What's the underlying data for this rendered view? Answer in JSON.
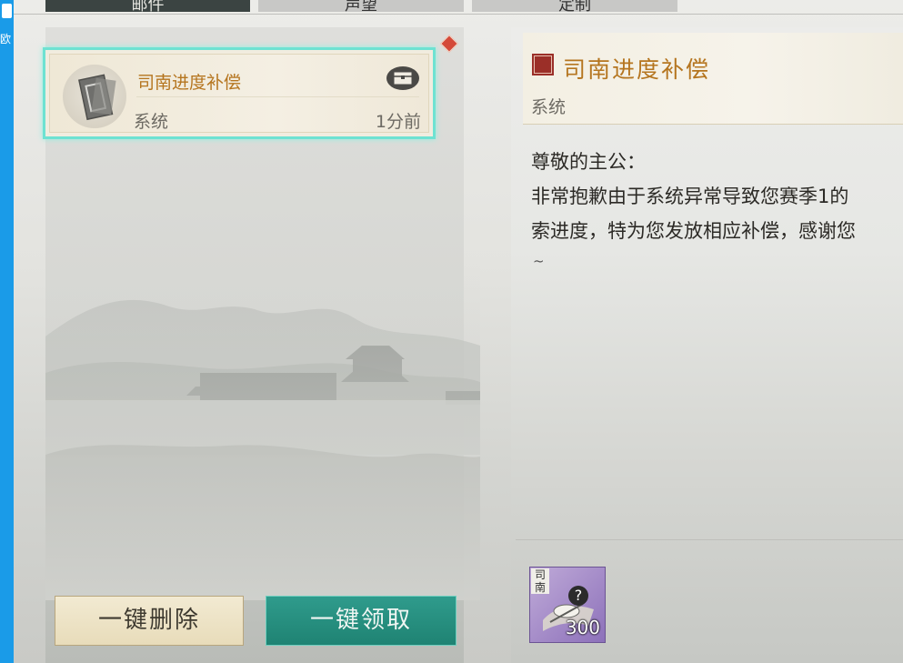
{
  "desktop": {
    "side_text": "欧"
  },
  "tabs": [
    {
      "label": "邮件"
    },
    {
      "label": "声望"
    },
    {
      "label": "定制"
    }
  ],
  "mail_list": {
    "items": [
      {
        "title": "司南进度补偿",
        "sender": "系统",
        "time": "1分前",
        "unread": true,
        "has_attachment": true
      }
    ]
  },
  "buttons": {
    "delete_all": "一键删除",
    "claim_all": "一键领取"
  },
  "detail": {
    "title": "司南进度补偿",
    "sender": "系统",
    "greeting": "尊敬的主公：",
    "body_lines": [
      "非常抱歉由于系统异常导致您赛季1的",
      "索进度，特为您发放相应补偿，感谢您"
    ],
    "closing": "~"
  },
  "rewards": [
    {
      "label": "司南",
      "count": "300"
    }
  ],
  "colors": {
    "selected_border": "#6ee2d2",
    "title_gold": "#b5751f",
    "claim_green": "#1f8373",
    "unread_red": "#d44a3a",
    "reward_purple": "#8d71ba"
  }
}
